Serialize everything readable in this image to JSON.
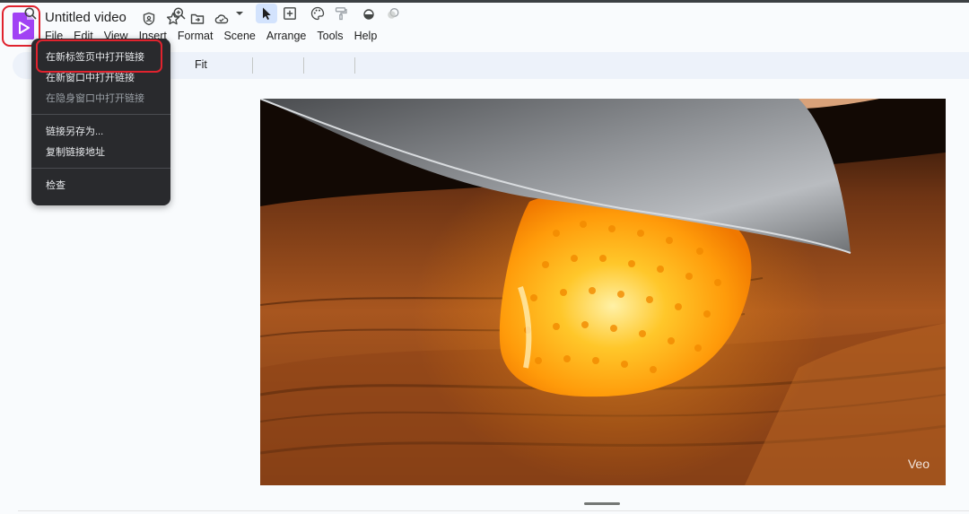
{
  "doc": {
    "title": "Untitled video"
  },
  "title_icons": [
    "shield-icon",
    "star-icon",
    "move-to-folder-icon",
    "cloud-saved-icon"
  ],
  "menubar": {
    "items": [
      "File",
      "Edit",
      "View",
      "Insert",
      "Format",
      "Scene",
      "Arrange",
      "Tools",
      "Help"
    ]
  },
  "toolbar": {
    "zoom_value": "Fit",
    "icons": [
      "search-icon",
      "zoom-icon",
      "dropdown-arrow-icon",
      "select-cursor-icon",
      "add-textbox-icon",
      "palette-icon",
      "paint-format-icon",
      "fill-color-icon",
      "effects-icon"
    ]
  },
  "context_menu": {
    "items": [
      {
        "label": "在新标签页中打开链接",
        "enabled": true
      },
      {
        "label": "在新窗口中打开链接",
        "enabled": true
      },
      {
        "label": "在隐身窗口中打开链接",
        "enabled": false
      },
      {
        "label": "链接另存为...",
        "enabled": true
      },
      {
        "label": "复制链接地址",
        "enabled": true
      },
      {
        "label": "检查",
        "enabled": true
      }
    ]
  },
  "video": {
    "watermark": "Veo"
  },
  "colors": {
    "accent": "#a142f4",
    "highlight_red": "#e0232e",
    "menu_bg": "#292a2d",
    "toolbar_bg": "#edf2fa"
  }
}
